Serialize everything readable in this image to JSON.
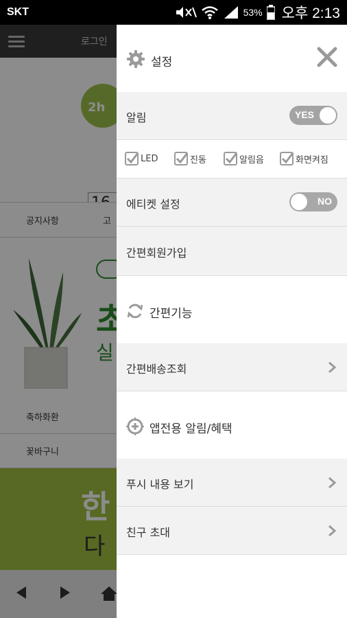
{
  "status_bar": {
    "carrier": "SKT",
    "battery": "53%",
    "time": "오후 2:13",
    "icons": [
      "mute-icon",
      "wifi-icon",
      "signal-icon",
      "battery-icon"
    ]
  },
  "background_app": {
    "login": "로그인",
    "logo_text": "2h",
    "phone_partial": "16",
    "tabs": [
      "공지사항",
      "고"
    ],
    "banner_big": "초",
    "banner_small": "실",
    "grid": [
      "축하화환",
      "꽃바구니"
    ],
    "green_line1": "한",
    "green_line2": "다"
  },
  "drawer": {
    "header": {
      "title": "설정",
      "icon": "gear-icon",
      "close_icon": "close-icon"
    },
    "notification": {
      "label": "알림",
      "toggle": "YES",
      "state": "on"
    },
    "options": [
      {
        "label": "LED",
        "checked": true
      },
      {
        "label": "진동",
        "checked": true
      },
      {
        "label": "알림음",
        "checked": true
      },
      {
        "label": "화면켜짐",
        "checked": true
      }
    ],
    "etiquette": {
      "label": "에티켓 설정",
      "toggle": "NO",
      "state": "off"
    },
    "signup": {
      "label": "간편회원가입"
    },
    "quick_section": {
      "label": "간편기능",
      "icon": "refresh-icon"
    },
    "delivery": {
      "label": "간편배송조회"
    },
    "app_section": {
      "label": "앱전용 알림/혜택",
      "icon": "plus-circle-icon"
    },
    "push": {
      "label": "푸시 내용 보기"
    },
    "invite": {
      "label": "친구 초대"
    }
  },
  "colors": {
    "toggle_on": "#a4a4a4",
    "row_grey": "#f2f2f2",
    "icon_grey": "#9a9a9a",
    "brand_green": "#9ec03e"
  }
}
